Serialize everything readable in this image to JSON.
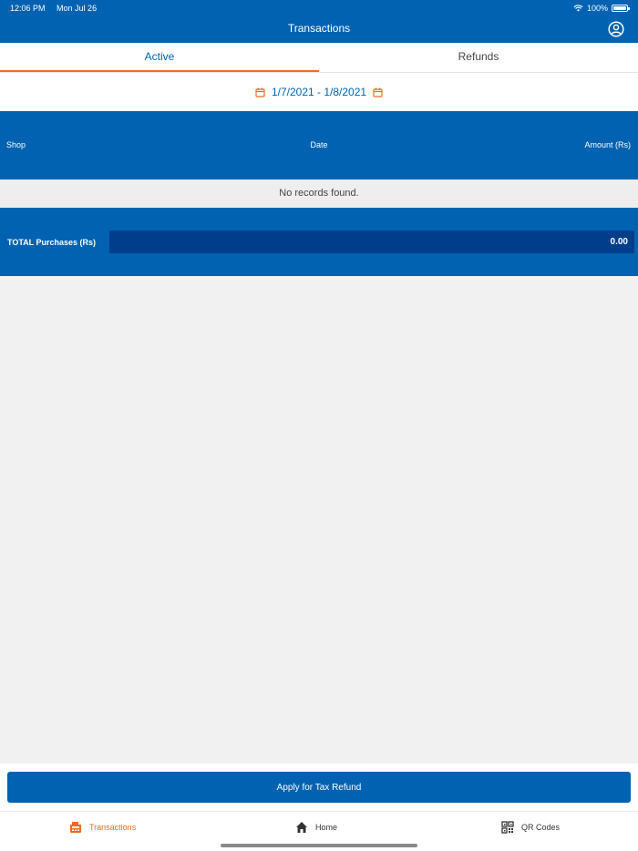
{
  "status_bar": {
    "time": "12:06 PM",
    "date": "Mon Jul 26",
    "battery": "100%"
  },
  "header": {
    "title": "Transactions"
  },
  "tabs": [
    {
      "label": "Active"
    },
    {
      "label": "Refunds"
    }
  ],
  "date_range": {
    "value": "1/7/2021 - 1/8/2021"
  },
  "table": {
    "columns": [
      "Shop",
      "Date",
      "Amount (Rs)"
    ],
    "empty_message": "No records found."
  },
  "totals": {
    "label": "TOTAL Purchases (Rs)",
    "value": "0.00"
  },
  "actions": {
    "apply_label": "Apply for Tax Refund"
  },
  "bottom_nav": [
    {
      "label": "Transactions",
      "icon": "register-icon"
    },
    {
      "label": "Home",
      "icon": "home-icon"
    },
    {
      "label": "QR Codes",
      "icon": "qr-icon"
    }
  ],
  "colors": {
    "primary": "#0062b1",
    "accent": "#f26a21",
    "dark_primary": "#003e8c"
  }
}
